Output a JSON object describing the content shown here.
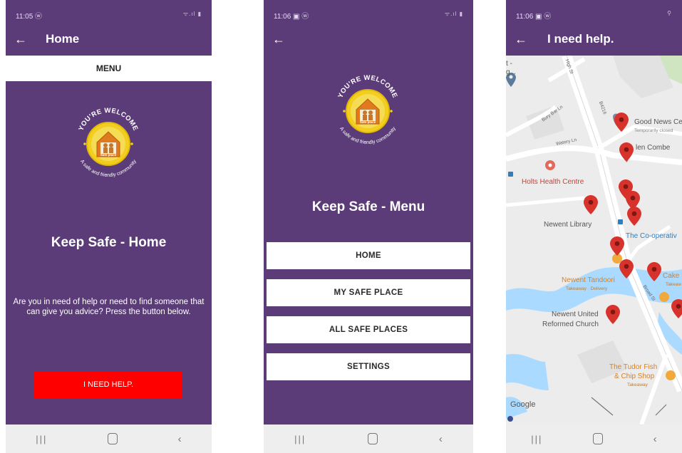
{
  "screen1": {
    "time": "11:05 ⓦ",
    "signal": "ᯤ.ıl ▮",
    "title": "Home",
    "menu_label": "MENU",
    "logo": {
      "top_text": "YOU'RE WELCOME",
      "bottom_text": "A safe and friendly community",
      "badge": "Safe place"
    },
    "heading": "Keep Safe - Home",
    "help_text": "Are you in need of help or need to find someone that can give you advice? Press the button below.",
    "help_button": "I NEED HELP."
  },
  "screen2": {
    "time": "11:06 ▣ ⓦ",
    "signal": "ᯤ.ıl ▮",
    "logo": {
      "top_text": "YOU'RE WELCOME",
      "bottom_text": "A safe and friendly community",
      "badge": "Safe place"
    },
    "heading": "Keep Safe - Menu",
    "menu_items": [
      "HOME",
      "MY SAFE PLACE",
      "ALL SAFE PLACES",
      "SETTINGS"
    ]
  },
  "screen3": {
    "time": "11:06 ▣ ⓦ",
    "signal": "⚲",
    "title": "I need help.",
    "map_labels": {
      "good_news": "Good News Cer",
      "good_news_sub": "Temporarily closed",
      "glen_combe": "len Combe",
      "holts": "Holts Health Centre",
      "library": "Newent Library",
      "coop": "The Co-operativ",
      "tandoori": "Newent Tandoori",
      "tandoori_sub": "Takeaway · Delivery",
      "cake": "Cake I",
      "cake_sub": "Takeaw",
      "united": "Newent United",
      "united2": "Reformed Church",
      "tudor": "The Tudor Fish",
      "tudor2": "& Chip Shop",
      "tudor_sub": "Takeaway",
      "street_high": "High St",
      "street_b4216": "B4216",
      "street_watery": "Watery Ln",
      "street_bury": "Bury Bar Ln",
      "street_broad": "Broad St",
      "corner1": "t -",
      "corner2": "g..."
    },
    "google_logo": "Google"
  },
  "nav": {
    "recent": "|||",
    "home": "",
    "back": "‹"
  },
  "back_arrow": "←"
}
